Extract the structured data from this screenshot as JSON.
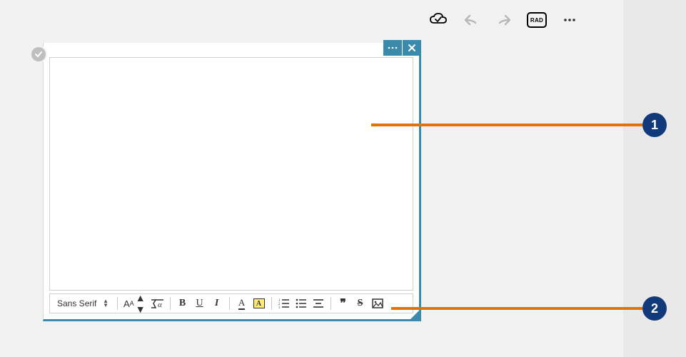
{
  "topbar": {
    "rad_label": "RAD"
  },
  "editor": {
    "content": ""
  },
  "toolbar": {
    "font_family_label": "Sans Serif"
  },
  "callouts": {
    "c1": "1",
    "c2": "2"
  }
}
